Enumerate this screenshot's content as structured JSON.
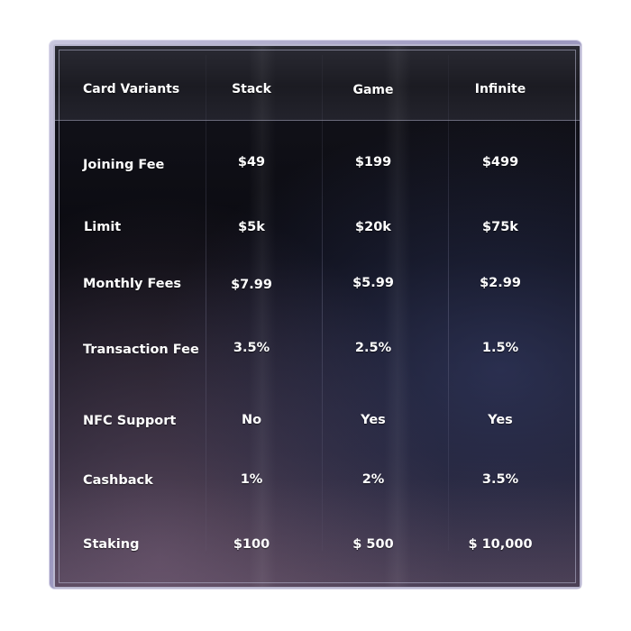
{
  "table": {
    "header": {
      "label": "Card Variants",
      "columns": [
        "Stack",
        "Game",
        "Infinite"
      ]
    },
    "rows": [
      {
        "label": "Joining Fee",
        "values": [
          "$49",
          "$199",
          "$499"
        ]
      },
      {
        "label": "Limit",
        "values": [
          "$5k",
          "$20k",
          "$75k"
        ]
      },
      {
        "label": "Monthly Fees",
        "values": [
          "$7.99",
          "$5.99",
          "$2.99"
        ]
      },
      {
        "label": "Transaction Fee",
        "values": [
          "3.5%",
          "2.5%",
          "1.5%"
        ]
      },
      {
        "label": "NFC Support",
        "values": [
          "No",
          "Yes",
          "Yes"
        ]
      },
      {
        "label": "Cashback",
        "values": [
          "1%",
          "2%",
          "3.5%"
        ]
      },
      {
        "label": "Staking",
        "values": [
          "$100",
          "$ 500",
          "$ 10,000"
        ]
      }
    ]
  },
  "colors": {
    "text": "#ffffff",
    "background": "#0a0a10",
    "border": "#b9b7cf"
  }
}
